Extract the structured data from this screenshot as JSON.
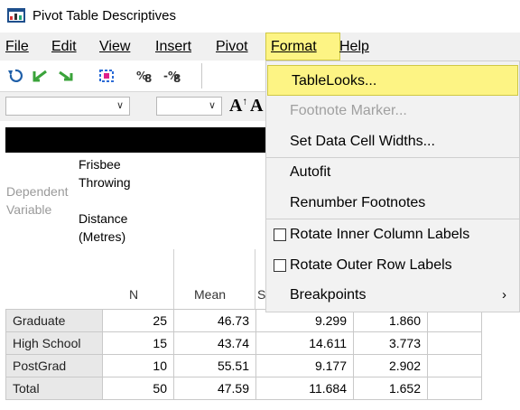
{
  "window": {
    "title": "Pivot Table Descriptives"
  },
  "menubar": {
    "items": [
      "File",
      "Edit",
      "View",
      "Insert",
      "Pivot",
      "Format",
      "Help"
    ],
    "active": "Format"
  },
  "toolbar": {
    "icons": [
      "undo-icon",
      "back-arrow-icon",
      "forward-arrow-icon",
      "transpose-icon",
      "pivot-rows-icon",
      "pivot-cols-icon"
    ],
    "font_increase": "A",
    "font_glyph_partial": "A"
  },
  "format_menu": {
    "items": [
      {
        "label": "TableLooks...",
        "state": "highlighted"
      },
      {
        "label": "Footnote Marker...",
        "state": "disabled"
      },
      {
        "label": "Set Data Cell Widths...",
        "state": "enabled"
      },
      {
        "label": "Autofit",
        "state": "enabled"
      },
      {
        "label": "Renumber Footnotes",
        "state": "enabled"
      },
      {
        "label": "Rotate Inner Column Labels",
        "state": "checkbox"
      },
      {
        "label": "Rotate Outer Row Labels",
        "state": "checkbox"
      },
      {
        "label": "Breakpoints",
        "state": "submenu"
      }
    ]
  },
  "pivot": {
    "dependent_variable_label": [
      "Dependent",
      "Variable"
    ],
    "variable_name": [
      "Frisbee",
      "Throwing",
      "Distance",
      "(Metres)"
    ],
    "columns": [
      "N",
      "Mean",
      "S"
    ],
    "rows": [
      {
        "label": "Graduate",
        "n": "25",
        "mean": "46.73",
        "sd": "9.299",
        "se": "1.860"
      },
      {
        "label": "High School",
        "n": "15",
        "mean": "43.74",
        "sd": "14.611",
        "se": "3.773"
      },
      {
        "label": "PostGrad",
        "n": "10",
        "mean": "55.51",
        "sd": "9.177",
        "se": "2.902"
      },
      {
        "label": "Total",
        "n": "50",
        "mean": "47.59",
        "sd": "11.684",
        "se": "1.652"
      }
    ]
  },
  "colors": {
    "highlight": "#fdf484",
    "menu_bg": "#f2f2f2",
    "row_label_bg": "#e8e8e8"
  }
}
